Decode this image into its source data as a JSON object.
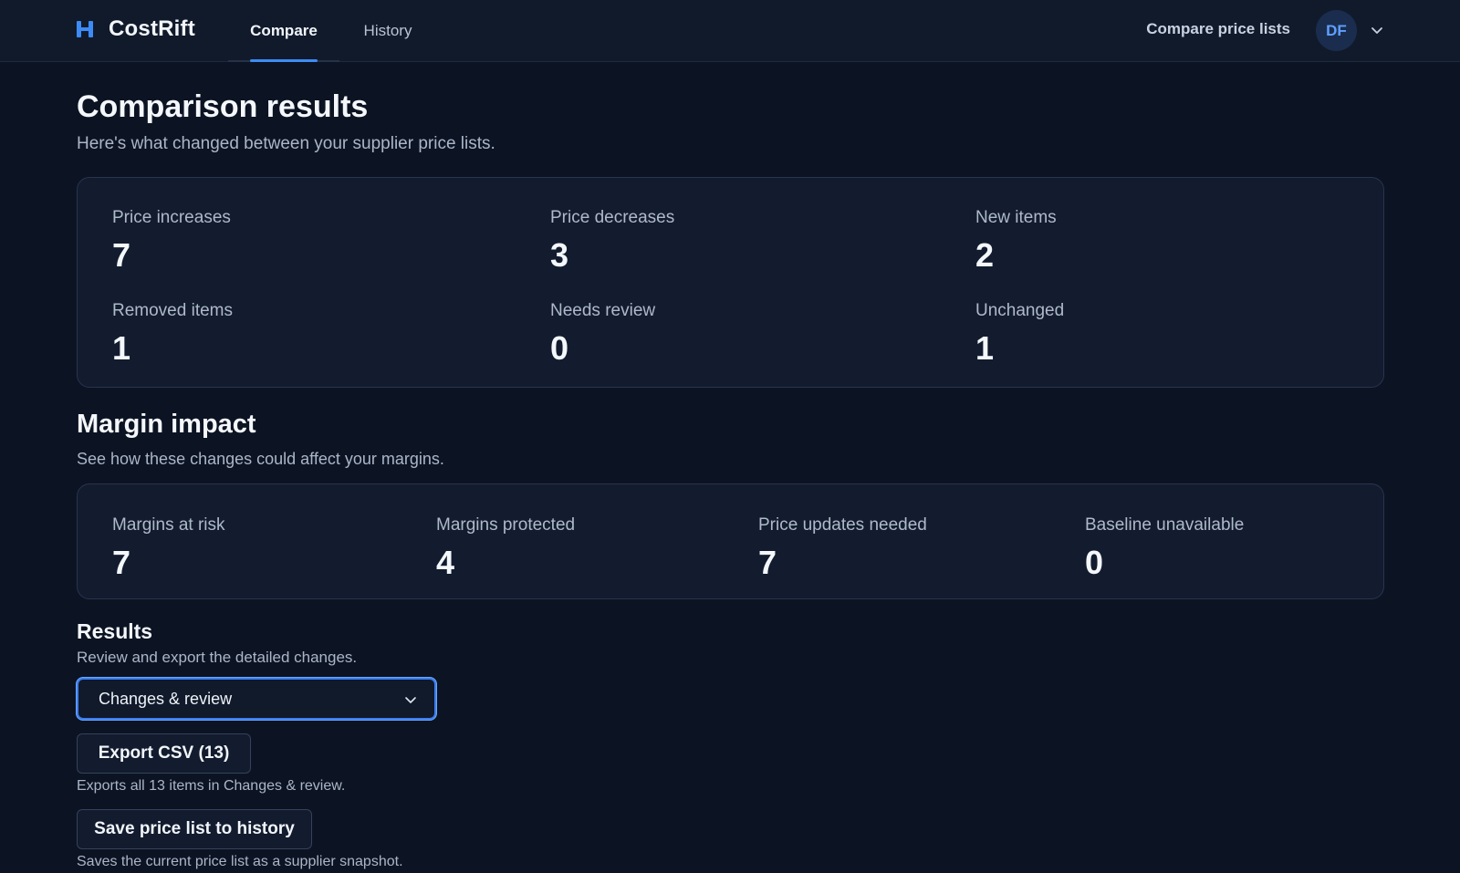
{
  "app": {
    "name": "CostRift",
    "logo_icon": "brand-logo-icon",
    "accent_color": "#3d8bf6"
  },
  "nav": {
    "tabs": [
      {
        "label": "Compare",
        "active": true
      },
      {
        "label": "History",
        "active": false
      }
    ],
    "right_link": "Compare price lists",
    "avatar_initials": "DF",
    "avatar_menu_icon": "chevron-down-icon"
  },
  "page": {
    "title": "Comparison results",
    "subtitle": "Here's what changed between your supplier price lists."
  },
  "changes": {
    "stats": [
      {
        "label": "Price increases",
        "value": "7"
      },
      {
        "label": "Price decreases",
        "value": "3"
      },
      {
        "label": "New items",
        "value": "2"
      },
      {
        "label": "Removed items",
        "value": "1"
      },
      {
        "label": "Needs review",
        "value": "0"
      },
      {
        "label": "Unchanged",
        "value": "1"
      }
    ]
  },
  "margin": {
    "title": "Margin impact",
    "subtitle": "See how these changes could affect your margins.",
    "stats": [
      {
        "label": "Margins at risk",
        "value": "7"
      },
      {
        "label": "Margins protected",
        "value": "4"
      },
      {
        "label": "Price updates needed",
        "value": "7"
      },
      {
        "label": "Baseline unavailable",
        "value": "0"
      }
    ]
  },
  "results": {
    "title": "Results",
    "subtitle": "Review and export the detailed changes.",
    "view_select": {
      "value": "Changes & review",
      "icon": "chevron-down-icon"
    },
    "export_button": "Export CSV (13)",
    "export_helper": "Exports all 13 items in Changes & review.",
    "save_button": "Save price list to history",
    "save_helper": "Saves the current price list as a supplier snapshot."
  }
}
